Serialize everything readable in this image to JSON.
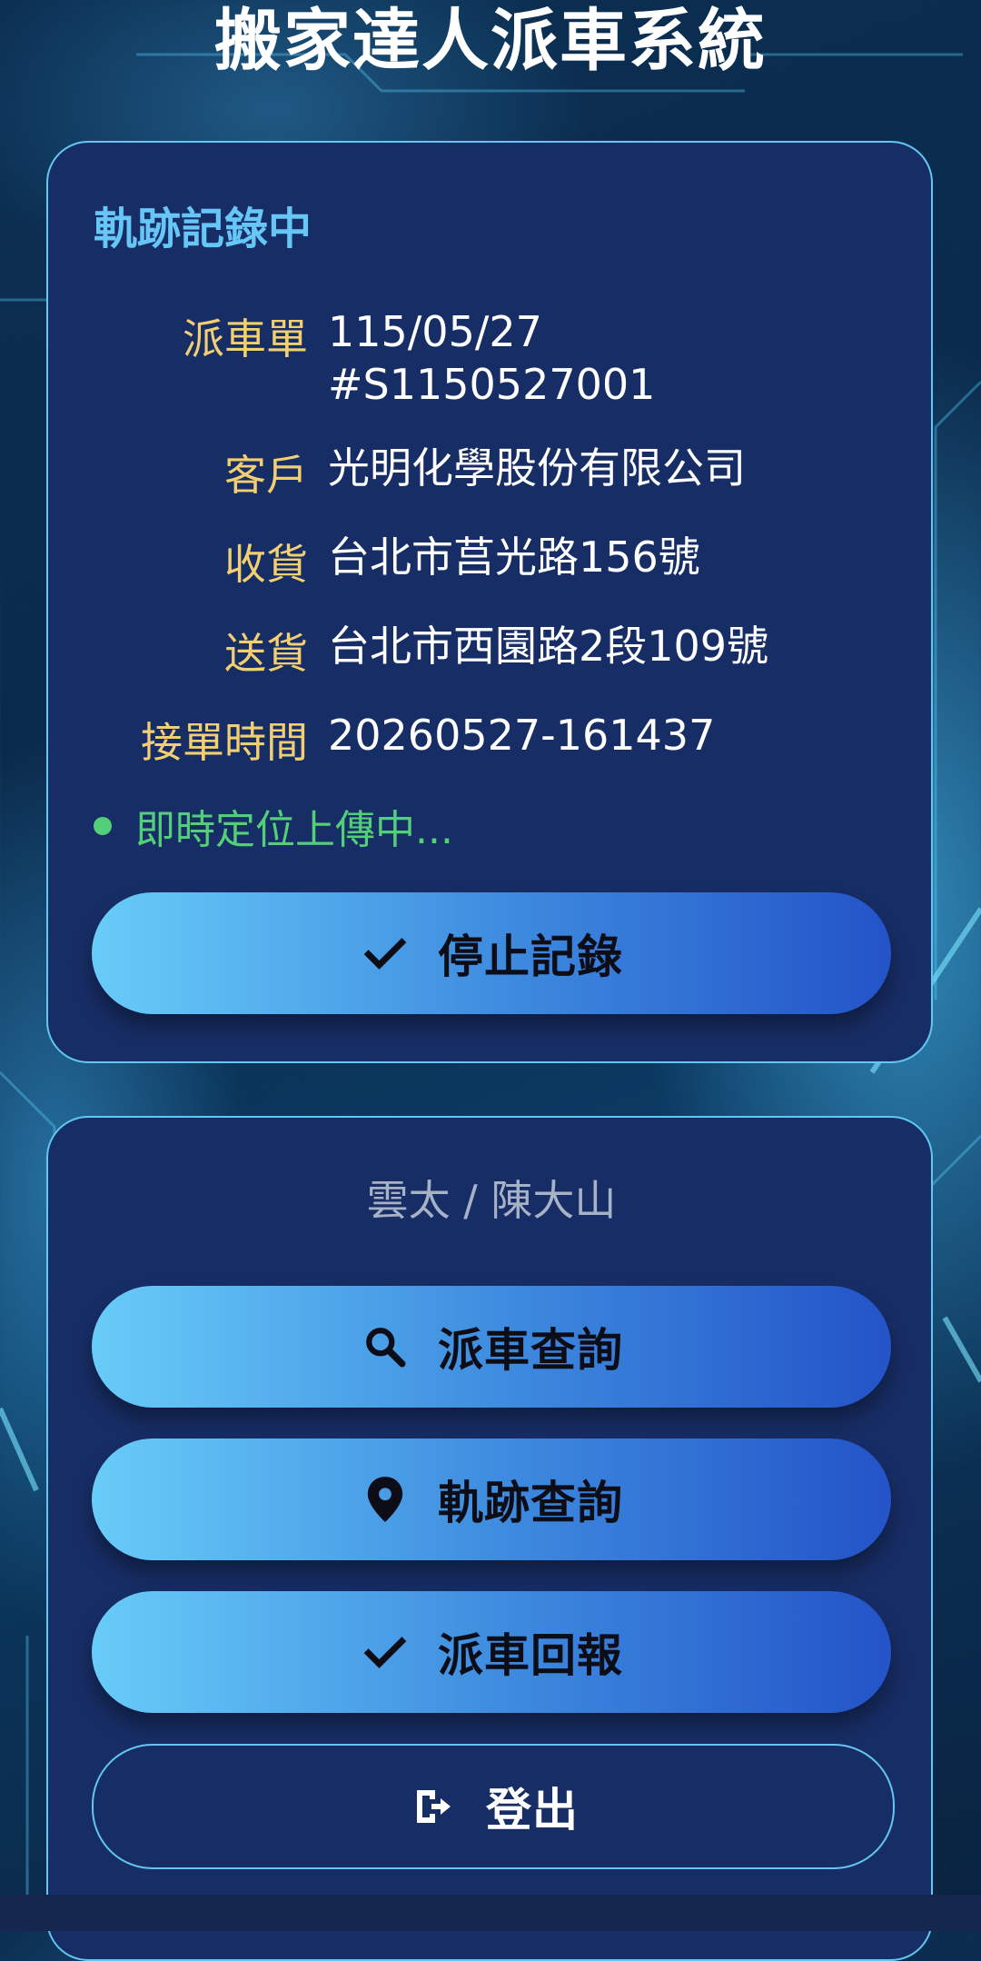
{
  "app": {
    "title": "搬家達人派車系統"
  },
  "tracking_card": {
    "heading": "軌跡記錄中",
    "rows": [
      {
        "label": "派車單",
        "value": "115/05/27",
        "value2": "#S1150527001"
      },
      {
        "label": "客戶",
        "value": "光明化學股份有限公司"
      },
      {
        "label": "收貨",
        "value": "台北市莒光路156號"
      },
      {
        "label": "送貨",
        "value": "台北市西園路2段109號"
      },
      {
        "label": "接單時間",
        "value": "20260527-161437"
      }
    ],
    "status": "即時定位上傳中...",
    "stop_button": {
      "label": "停止記錄",
      "icon": "check-icon"
    }
  },
  "menu_card": {
    "user": "雲太 / 陳大山",
    "buttons": [
      {
        "label": "派車查詢",
        "icon": "search-icon"
      },
      {
        "label": "軌跡查詢",
        "icon": "location-pin-icon"
      },
      {
        "label": "派車回報",
        "icon": "check-icon"
      }
    ],
    "logout_button": {
      "label": "登出",
      "icon": "logout-icon"
    }
  },
  "colors": {
    "card_bg": "#172d65",
    "card_border": "#62c7f3",
    "heading": "#66c6f5",
    "label": "#f2cf70",
    "status": "#54cf79",
    "button_gradient_start": "#68ccf8",
    "button_gradient_end": "#2353c8"
  }
}
